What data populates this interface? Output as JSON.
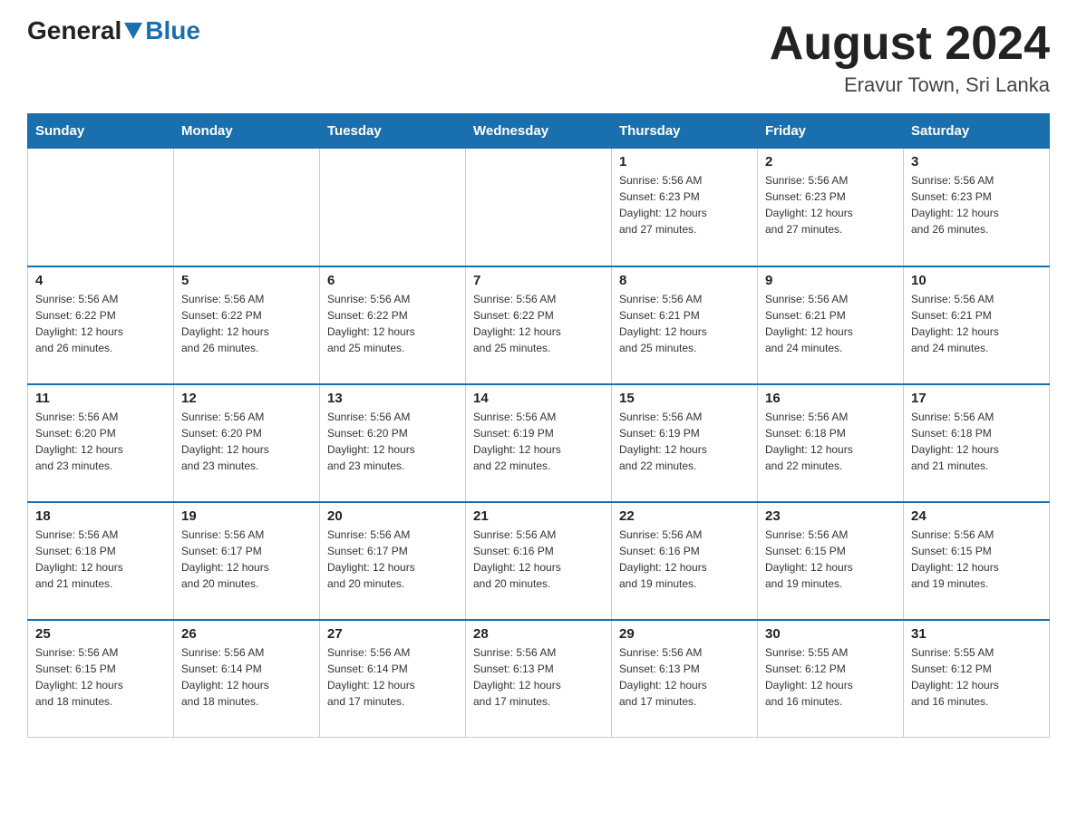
{
  "header": {
    "logo_general": "General",
    "logo_blue": "Blue",
    "title": "August 2024",
    "subtitle": "Eravur Town, Sri Lanka"
  },
  "days_of_week": [
    "Sunday",
    "Monday",
    "Tuesday",
    "Wednesday",
    "Thursday",
    "Friday",
    "Saturday"
  ],
  "weeks": [
    [
      {
        "day": "",
        "info": ""
      },
      {
        "day": "",
        "info": ""
      },
      {
        "day": "",
        "info": ""
      },
      {
        "day": "",
        "info": ""
      },
      {
        "day": "1",
        "info": "Sunrise: 5:56 AM\nSunset: 6:23 PM\nDaylight: 12 hours\nand 27 minutes."
      },
      {
        "day": "2",
        "info": "Sunrise: 5:56 AM\nSunset: 6:23 PM\nDaylight: 12 hours\nand 27 minutes."
      },
      {
        "day": "3",
        "info": "Sunrise: 5:56 AM\nSunset: 6:23 PM\nDaylight: 12 hours\nand 26 minutes."
      }
    ],
    [
      {
        "day": "4",
        "info": "Sunrise: 5:56 AM\nSunset: 6:22 PM\nDaylight: 12 hours\nand 26 minutes."
      },
      {
        "day": "5",
        "info": "Sunrise: 5:56 AM\nSunset: 6:22 PM\nDaylight: 12 hours\nand 26 minutes."
      },
      {
        "day": "6",
        "info": "Sunrise: 5:56 AM\nSunset: 6:22 PM\nDaylight: 12 hours\nand 25 minutes."
      },
      {
        "day": "7",
        "info": "Sunrise: 5:56 AM\nSunset: 6:22 PM\nDaylight: 12 hours\nand 25 minutes."
      },
      {
        "day": "8",
        "info": "Sunrise: 5:56 AM\nSunset: 6:21 PM\nDaylight: 12 hours\nand 25 minutes."
      },
      {
        "day": "9",
        "info": "Sunrise: 5:56 AM\nSunset: 6:21 PM\nDaylight: 12 hours\nand 24 minutes."
      },
      {
        "day": "10",
        "info": "Sunrise: 5:56 AM\nSunset: 6:21 PM\nDaylight: 12 hours\nand 24 minutes."
      }
    ],
    [
      {
        "day": "11",
        "info": "Sunrise: 5:56 AM\nSunset: 6:20 PM\nDaylight: 12 hours\nand 23 minutes."
      },
      {
        "day": "12",
        "info": "Sunrise: 5:56 AM\nSunset: 6:20 PM\nDaylight: 12 hours\nand 23 minutes."
      },
      {
        "day": "13",
        "info": "Sunrise: 5:56 AM\nSunset: 6:20 PM\nDaylight: 12 hours\nand 23 minutes."
      },
      {
        "day": "14",
        "info": "Sunrise: 5:56 AM\nSunset: 6:19 PM\nDaylight: 12 hours\nand 22 minutes."
      },
      {
        "day": "15",
        "info": "Sunrise: 5:56 AM\nSunset: 6:19 PM\nDaylight: 12 hours\nand 22 minutes."
      },
      {
        "day": "16",
        "info": "Sunrise: 5:56 AM\nSunset: 6:18 PM\nDaylight: 12 hours\nand 22 minutes."
      },
      {
        "day": "17",
        "info": "Sunrise: 5:56 AM\nSunset: 6:18 PM\nDaylight: 12 hours\nand 21 minutes."
      }
    ],
    [
      {
        "day": "18",
        "info": "Sunrise: 5:56 AM\nSunset: 6:18 PM\nDaylight: 12 hours\nand 21 minutes."
      },
      {
        "day": "19",
        "info": "Sunrise: 5:56 AM\nSunset: 6:17 PM\nDaylight: 12 hours\nand 20 minutes."
      },
      {
        "day": "20",
        "info": "Sunrise: 5:56 AM\nSunset: 6:17 PM\nDaylight: 12 hours\nand 20 minutes."
      },
      {
        "day": "21",
        "info": "Sunrise: 5:56 AM\nSunset: 6:16 PM\nDaylight: 12 hours\nand 20 minutes."
      },
      {
        "day": "22",
        "info": "Sunrise: 5:56 AM\nSunset: 6:16 PM\nDaylight: 12 hours\nand 19 minutes."
      },
      {
        "day": "23",
        "info": "Sunrise: 5:56 AM\nSunset: 6:15 PM\nDaylight: 12 hours\nand 19 minutes."
      },
      {
        "day": "24",
        "info": "Sunrise: 5:56 AM\nSunset: 6:15 PM\nDaylight: 12 hours\nand 19 minutes."
      }
    ],
    [
      {
        "day": "25",
        "info": "Sunrise: 5:56 AM\nSunset: 6:15 PM\nDaylight: 12 hours\nand 18 minutes."
      },
      {
        "day": "26",
        "info": "Sunrise: 5:56 AM\nSunset: 6:14 PM\nDaylight: 12 hours\nand 18 minutes."
      },
      {
        "day": "27",
        "info": "Sunrise: 5:56 AM\nSunset: 6:14 PM\nDaylight: 12 hours\nand 17 minutes."
      },
      {
        "day": "28",
        "info": "Sunrise: 5:56 AM\nSunset: 6:13 PM\nDaylight: 12 hours\nand 17 minutes."
      },
      {
        "day": "29",
        "info": "Sunrise: 5:56 AM\nSunset: 6:13 PM\nDaylight: 12 hours\nand 17 minutes."
      },
      {
        "day": "30",
        "info": "Sunrise: 5:55 AM\nSunset: 6:12 PM\nDaylight: 12 hours\nand 16 minutes."
      },
      {
        "day": "31",
        "info": "Sunrise: 5:55 AM\nSunset: 6:12 PM\nDaylight: 12 hours\nand 16 minutes."
      }
    ]
  ]
}
